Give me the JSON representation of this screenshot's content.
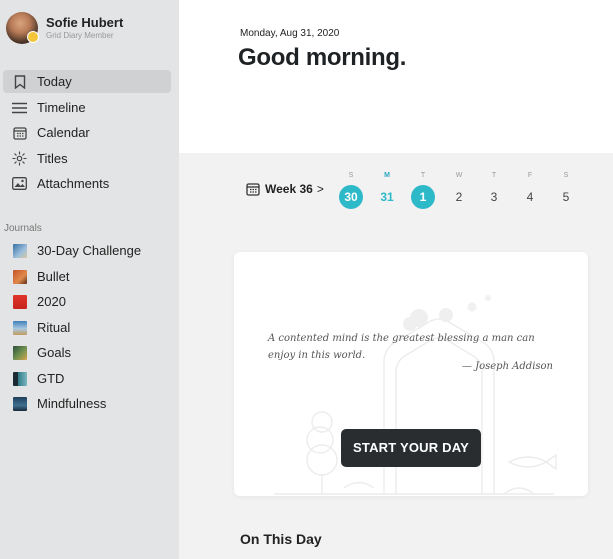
{
  "profile": {
    "name": "Sofie Hubert",
    "role": "Grid Diary Member"
  },
  "nav": {
    "items": [
      {
        "label": "Today",
        "icon": "bookmark-icon"
      },
      {
        "label": "Timeline",
        "icon": "list-icon"
      },
      {
        "label": "Calendar",
        "icon": "calendar-icon"
      },
      {
        "label": "Titles",
        "icon": "sparkle-icon"
      },
      {
        "label": "Attachments",
        "icon": "image-icon"
      }
    ],
    "active": "Today"
  },
  "journals": {
    "title": "Journals",
    "items": [
      {
        "label": "30-Day Challenge",
        "color": "#3b6fa3"
      },
      {
        "label": "Bullet",
        "color": "#c4522b"
      },
      {
        "label": "2020",
        "color": "#e0342c"
      },
      {
        "label": "Ritual",
        "color": "#3f7fb8"
      },
      {
        "label": "Goals",
        "color": "#2d4d3a"
      },
      {
        "label": "GTD",
        "color": "#2f7a86"
      },
      {
        "label": "Mindfulness",
        "color": "#1f3f5c"
      }
    ]
  },
  "main": {
    "date": "Monday, Aug 31, 2020",
    "greeting": "Good morning.",
    "week_label": "Week 36",
    "week_chevron": ">",
    "days": [
      {
        "letter": "S",
        "num": "30",
        "style": "filled"
      },
      {
        "letter": "M",
        "num": "31",
        "style": "accent"
      },
      {
        "letter": "T",
        "num": "1",
        "style": "filled"
      },
      {
        "letter": "W",
        "num": "2",
        "style": "plain"
      },
      {
        "letter": "T",
        "num": "3",
        "style": "plain"
      },
      {
        "letter": "F",
        "num": "4",
        "style": "plain"
      },
      {
        "letter": "S",
        "num": "5",
        "style": "plain"
      }
    ],
    "quote": "A contented mind is the greatest blessing a man can enjoy in this world.",
    "quote_author": "— Joseph Addison",
    "start_button": "START YOUR DAY",
    "on_this_day": "On This Day"
  },
  "colors": {
    "accent": "#2eb9c9",
    "sidebar_bg": "#e3e4e5",
    "button_bg": "#2a2d30"
  }
}
